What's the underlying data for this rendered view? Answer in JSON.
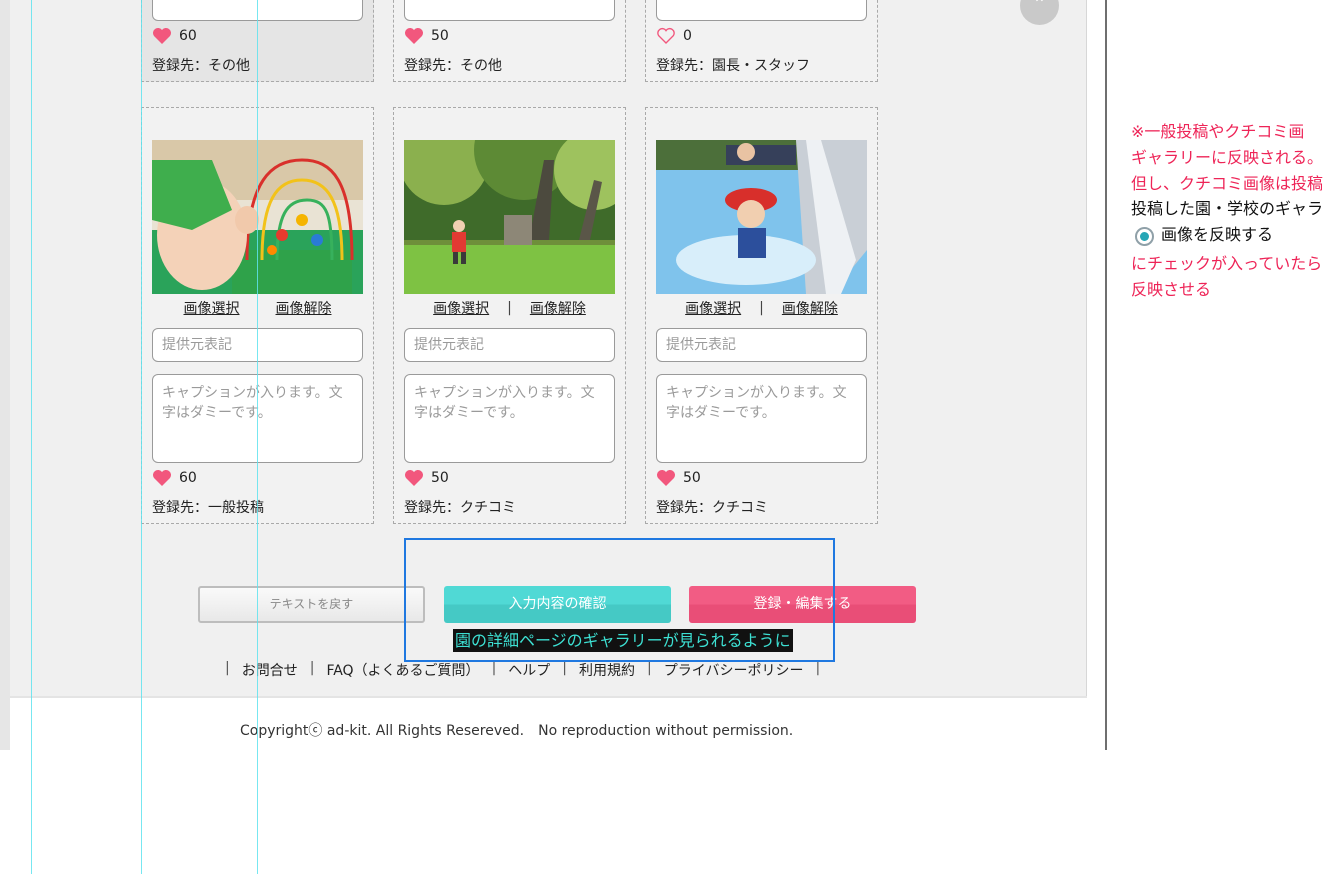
{
  "top_cards": [
    {
      "likes": "60",
      "liked": true,
      "registered": "登録先：その他"
    },
    {
      "likes": "50",
      "liked": true,
      "registered": "登録先：その他"
    },
    {
      "likes": "0",
      "liked": false,
      "registered": "登録先：園長・スタッフ"
    }
  ],
  "cards": [
    {
      "select_label": "画像選択",
      "separator": "",
      "remove_label": "画像解除",
      "credit_placeholder": "提供元表記",
      "caption_placeholder": "キャプションが入ります。文字はダミーです。",
      "likes": "60",
      "registered": "登録先：一般投稿"
    },
    {
      "select_label": "画像選択",
      "separator": "|",
      "remove_label": "画像解除",
      "credit_placeholder": "提供元表記",
      "caption_placeholder": "キャプションが入ります。文字はダミーです。",
      "likes": "50",
      "registered": "登録先：クチコミ"
    },
    {
      "select_label": "画像選択",
      "separator": "|",
      "remove_label": "画像解除",
      "credit_placeholder": "提供元表記",
      "caption_placeholder": "キャプションが入ります。文字はダミーです。",
      "likes": "50",
      "registered": "登録先：クチコミ"
    }
  ],
  "buttons": {
    "back": "テキストを戻す",
    "confirm": "入力内容の確認",
    "register": "登録・編集する"
  },
  "annotation_caption": "園の詳細ページのギャラリーが見られるように",
  "footer": {
    "links": [
      "お問合せ",
      "FAQ（よくあるご質問）",
      "ヘルプ",
      "利用規約",
      "プライバシーポリシー"
    ],
    "separator": "|",
    "copyright": "Copyrightⓒ ad-kit. All Rights Resereved.　No reproduction without permission."
  },
  "side_note": {
    "line1": "※一般投稿やクチコミ画",
    "line2": "ギャラリーに反映される。",
    "line3": "但し、クチコミ画像は投稿",
    "line4": "投稿した園・学校のギャラ",
    "radio_label": "画像を反映する",
    "line6": "にチェックが入っていたら",
    "line7": "反映させる"
  },
  "colors": {
    "accent_pink": "#e94e77",
    "accent_teal": "#45c9c5",
    "note_red": "#ee2457",
    "highlight_blue": "#1f78e0"
  },
  "icons": {
    "scroll_top": "chevron-up-icon",
    "like": "heart-icon"
  }
}
